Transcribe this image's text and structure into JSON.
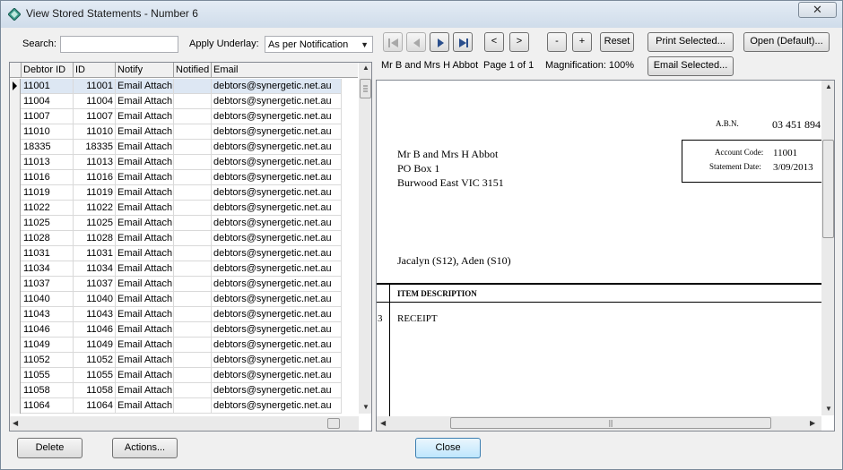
{
  "window": {
    "title": "View Stored Statements - Number 6"
  },
  "search": {
    "label": "Search:",
    "value": ""
  },
  "underlay": {
    "label": "Apply Underlay:",
    "selected": "As per Notification"
  },
  "nav": {
    "prev_label": "<",
    "next_label": ">",
    "minus_label": "-",
    "plus_label": "+",
    "reset_label": "Reset"
  },
  "actions": {
    "print_selected": "Print Selected...",
    "open_default": "Open (Default)...",
    "email_selected": "Email Selected..."
  },
  "status": {
    "recipient": "Mr B and Mrs H Abbot",
    "page": "Page 1 of 1",
    "magnification": "Magnification: 100%"
  },
  "table": {
    "headers": [
      "Debtor ID",
      "ID",
      "Notify",
      "Notified",
      "Email"
    ],
    "rows": [
      [
        "11001",
        "11001",
        "Email Attach",
        "",
        "debtors@synergetic.net.au"
      ],
      [
        "11004",
        "11004",
        "Email Attach",
        "",
        "debtors@synergetic.net.au"
      ],
      [
        "11007",
        "11007",
        "Email Attach",
        "",
        "debtors@synergetic.net.au"
      ],
      [
        "11010",
        "11010",
        "Email Attach",
        "",
        "debtors@synergetic.net.au"
      ],
      [
        "18335",
        "18335",
        "Email Attach",
        "",
        "debtors@synergetic.net.au"
      ],
      [
        "11013",
        "11013",
        "Email Attach",
        "",
        "debtors@synergetic.net.au"
      ],
      [
        "11016",
        "11016",
        "Email Attach",
        "",
        "debtors@synergetic.net.au"
      ],
      [
        "11019",
        "11019",
        "Email Attach",
        "",
        "debtors@synergetic.net.au"
      ],
      [
        "11022",
        "11022",
        "Email Attach",
        "",
        "debtors@synergetic.net.au"
      ],
      [
        "11025",
        "11025",
        "Email Attach",
        "",
        "debtors@synergetic.net.au"
      ],
      [
        "11028",
        "11028",
        "Email Attach",
        "",
        "debtors@synergetic.net.au"
      ],
      [
        "11031",
        "11031",
        "Email Attach",
        "",
        "debtors@synergetic.net.au"
      ],
      [
        "11034",
        "11034",
        "Email Attach",
        "",
        "debtors@synergetic.net.au"
      ],
      [
        "11037",
        "11037",
        "Email Attach",
        "",
        "debtors@synergetic.net.au"
      ],
      [
        "11040",
        "11040",
        "Email Attach",
        "",
        "debtors@synergetic.net.au"
      ],
      [
        "11043",
        "11043",
        "Email Attach",
        "",
        "debtors@synergetic.net.au"
      ],
      [
        "11046",
        "11046",
        "Email Attach",
        "",
        "debtors@synergetic.net.au"
      ],
      [
        "11049",
        "11049",
        "Email Attach",
        "",
        "debtors@synergetic.net.au"
      ],
      [
        "11052",
        "11052",
        "Email Attach",
        "",
        "debtors@synergetic.net.au"
      ],
      [
        "11055",
        "11055",
        "Email Attach",
        "",
        "debtors@synergetic.net.au"
      ],
      [
        "11058",
        "11058",
        "Email Attach",
        "",
        "debtors@synergetic.net.au"
      ],
      [
        "11064",
        "11064",
        "Email Attach",
        "",
        "debtors@synergetic.net.au"
      ]
    ]
  },
  "statement": {
    "abn_label": "A.B.N.",
    "abn_value": "03 451 894",
    "address": [
      "Mr B and Mrs H Abbot",
      "PO Box 1",
      "Burwood East VIC 3151"
    ],
    "account_code_label": "Account Code:",
    "account_code_value": "11001",
    "statement_date_label": "Statement Date:",
    "statement_date_value": "3/09/2013",
    "students": "Jacalyn (S12), Aden (S10)",
    "item_header": "ITEM DESCRIPTION",
    "line_qty": "3",
    "line_desc": "RECEIPT"
  },
  "footer": {
    "delete_label": "Delete",
    "actions_label": "Actions...",
    "close_label": "Close"
  },
  "colors": {
    "selected_row": "#dde7f3",
    "default_button": "#bee6fd",
    "nav_icon": "#2a4e8c"
  }
}
